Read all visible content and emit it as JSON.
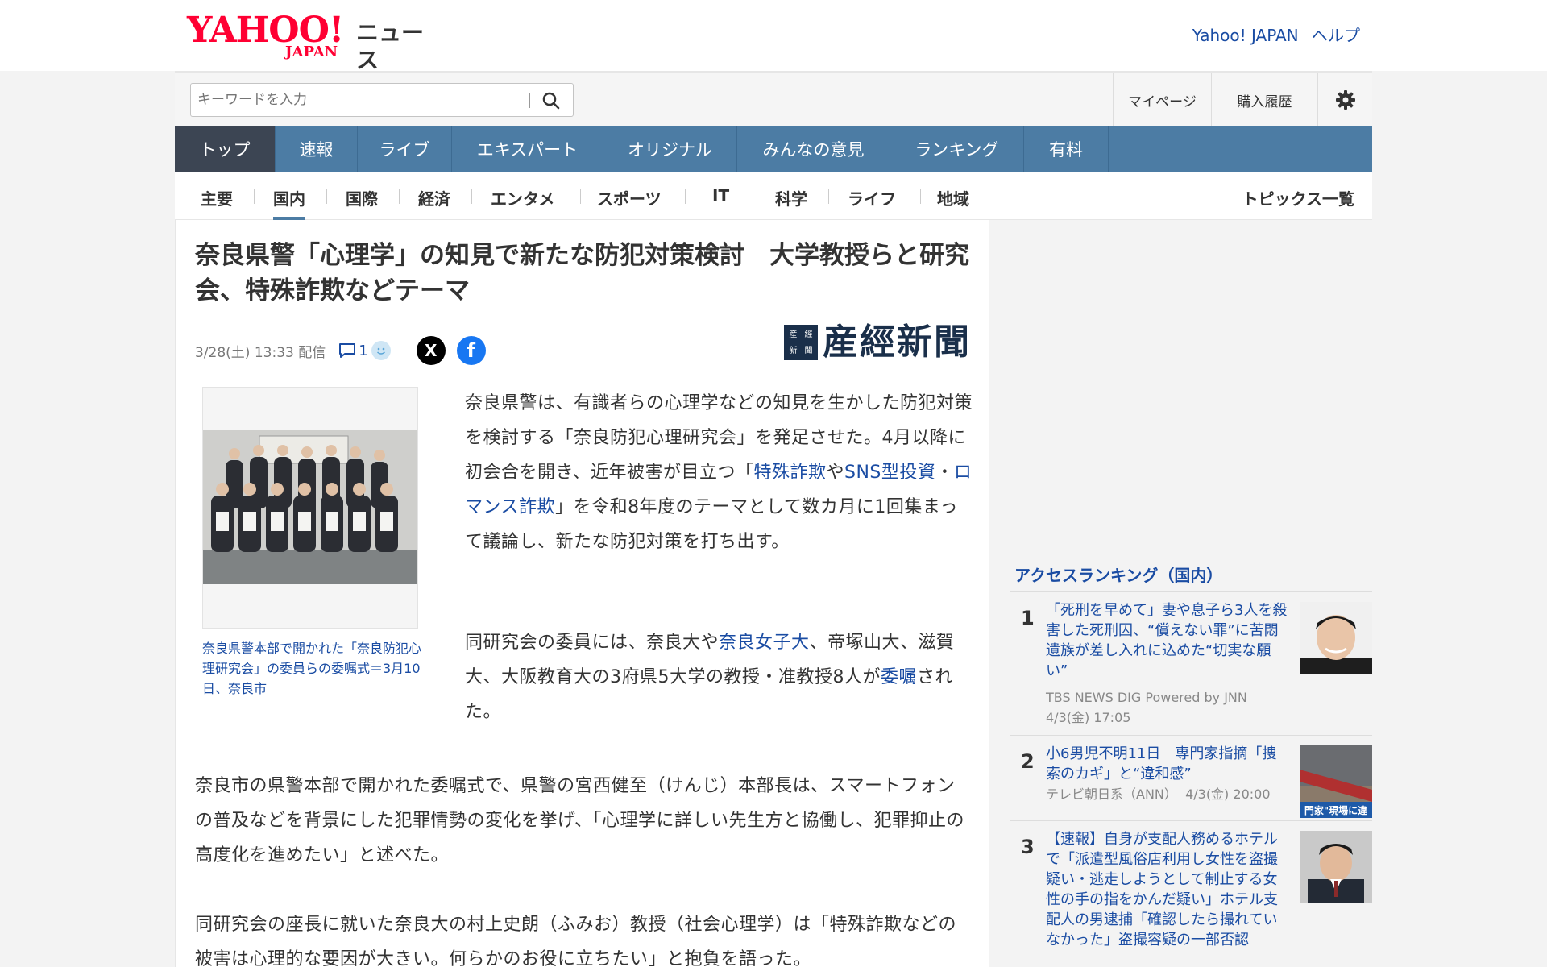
{
  "header": {
    "logo_main": "YAHOO!",
    "logo_sub": "JAPAN",
    "logo_news": "ニュース",
    "link_yahoo": "Yahoo! JAPAN",
    "link_help": "ヘルプ"
  },
  "search": {
    "placeholder": "キーワードを入力",
    "mypage": "マイページ",
    "history": "購入履歴"
  },
  "main_nav": [
    "トップ",
    "速報",
    "ライブ",
    "エキスパート",
    "オリジナル",
    "みんなの意見",
    "ランキング",
    "有料"
  ],
  "sub_nav": {
    "items": [
      "主要",
      "国内",
      "国際",
      "経済",
      "エンタメ",
      "スポーツ",
      "IT",
      "科学",
      "ライフ",
      "地域"
    ],
    "active": "国内",
    "topics": "トピックス一覧"
  },
  "article": {
    "title": "奈良県警「心理学」の知見で新たな防犯対策検討　大学教授らと研究会、特殊詐欺などテーマ",
    "date": "3/28(土) 13:33 配信",
    "comment_count": "1",
    "share_x": "X",
    "share_facebook": "f",
    "source_name": "産經新聞",
    "source_mark": [
      "産",
      "經",
      "新",
      "聞"
    ],
    "photo_caption": "奈良県警本部で開かれた「奈良防犯心理研究会」の委員らの委嘱式＝3月10日、奈良市",
    "p1_a": "奈良県警は、有識者らの心理学などの知見を生かした防犯対策を検討する「奈良防犯心理研究会」を発足させた。4月以降に初会合を開き、近年被害が目立つ「",
    "p1_link1": "特殊詐欺",
    "p1_b": "や",
    "p1_link2": "SNS型投資",
    "p1_c": "・",
    "p1_link3": "ロマンス詐欺",
    "p1_d": "」を令和8年度のテーマとして数カ月に1回集まって議論し、新たな防犯対策を打ち出す。",
    "p2_a": "同研究会の委員には、奈良大や",
    "p2_link1": "奈良女子大",
    "p2_b": "、帝塚山大、滋賀大、大阪教育大の3府県5大学の教授・准教授8人が",
    "p2_link2": "委嘱",
    "p2_c": "された。",
    "p3": "奈良市の県警本部で開かれた委嘱式で、県警の宮西健至（けんじ）本部長は、スマートフォンの普及などを背景にした犯罪情勢の変化を挙げ、「心理学に詳しい先生方と協働し、犯罪抑止の高度化を進めたい」と述べた。",
    "p4": "同研究会の座長に就いた奈良大の村上史朗（ふみお）教授（社会心理学）は「特殊詐欺などの被害は心理的な要因が大きい。何らかのお役に立ちたい」と抱負を語った。"
  },
  "ranking": {
    "title": "アクセスランキング（国内）",
    "items": [
      {
        "rank": "1",
        "title": "「死刑を早めて」妻や息子ら3人を殺害した死刑囚、“償えない罪”に苦悶　遺族が差し入れに込めた“切実な願い”",
        "source": "TBS NEWS DIG Powered by JNN",
        "date": "4/3(金) 17:05"
      },
      {
        "rank": "2",
        "title": "小6男児不明11日　専門家指摘「捜索のカギ」と“違和感”",
        "source": "テレビ朝日系（ANN）",
        "date": "4/3(金) 20:00",
        "thumb_text": "門家\"現場に違"
      },
      {
        "rank": "3",
        "title": "【速報】自身が支配人務めるホテルで「派遣型風俗店利用し女性を盗撮疑い・逃走しようとして制止する女性の手の指をかんだ疑い」ホテル支配人の男逮捕「確認したら撮れていなかった」盗撮容疑の一部否認"
      }
    ]
  },
  "colors": {
    "yahoo_red": "#ff0033",
    "nav_blue": "#4c7ca4",
    "nav_active": "#3c4553",
    "link_blue": "#1a4ca3"
  }
}
